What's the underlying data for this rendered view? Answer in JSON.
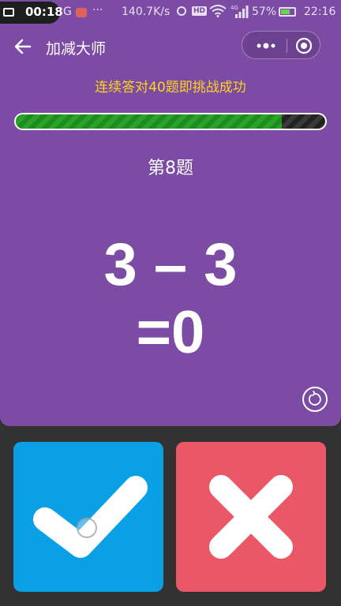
{
  "status_bar": {
    "recording_time": "00:18",
    "carrier_fragment": "G",
    "more": "···",
    "net_speed": "140.7K/s",
    "hd_badge": "HD",
    "network_type": "4G",
    "battery_percent": "57%",
    "time": "22:16"
  },
  "nav": {
    "title": "加减大师"
  },
  "game": {
    "challenge_text": "连续答对40题即挑战成功",
    "progress": 0.86,
    "question_label": "第8题",
    "expression": "3 – 3",
    "answer": "=0"
  },
  "colors": {
    "panel": "#7c4ba4",
    "challenge_text": "#ffd21f",
    "correct_button": "#0aa0e6",
    "wrong_button": "#ea5867",
    "progress_fill": "#2aa32a"
  },
  "icons": {
    "back": "arrow-left-icon",
    "more": "more-dots-icon",
    "close": "target-close-icon",
    "replay": "refresh-icon",
    "correct": "checkmark-icon",
    "wrong": "cross-icon"
  }
}
